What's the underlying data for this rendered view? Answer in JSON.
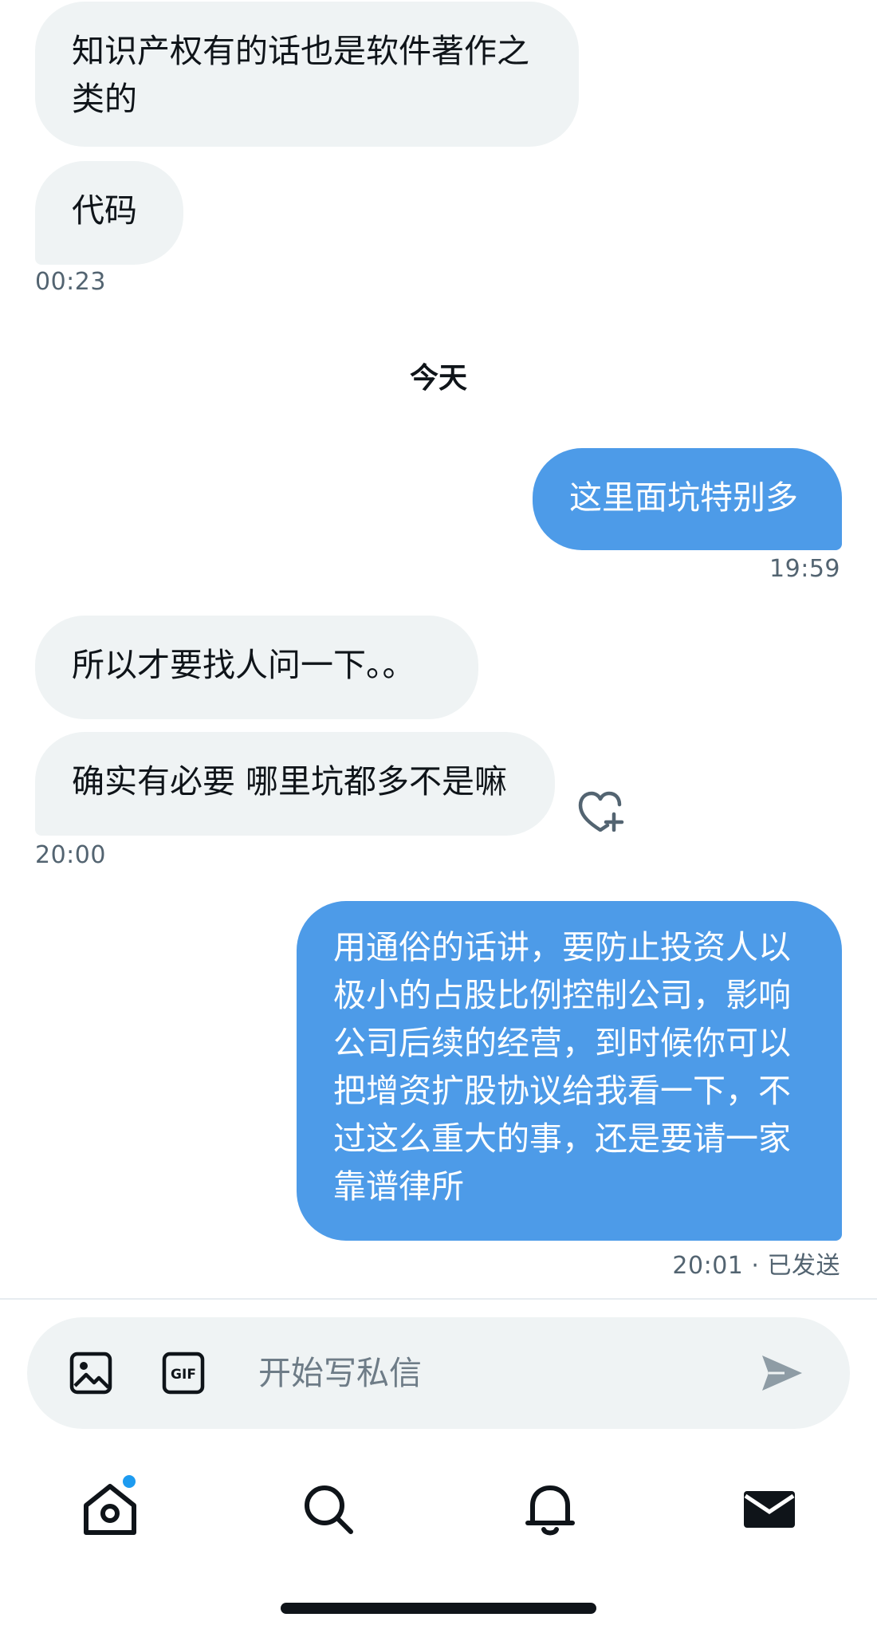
{
  "messages": [
    {
      "text": "知识产权有的话也是软件著作之类的",
      "sender": "other"
    },
    {
      "text": "代码",
      "sender": "other",
      "time": "00:23"
    },
    {
      "separator": "今天"
    },
    {
      "text": "这里面坑特别多",
      "sender": "me",
      "time": "19:59"
    },
    {
      "text": "所以才要找人问一下。。",
      "sender": "other"
    },
    {
      "text": "确实有必要 哪里坑都多不是嘛",
      "sender": "other",
      "time": "20:00",
      "reaction_icon": "heart-plus-icon"
    },
    {
      "text": "用通俗的话讲，要防止投资人以极小的占股比例控制公司，影响公司后续的经营，到时候你可以把增资扩股协议给我看一下，不过这么重大的事，还是要请一家靠谱律所",
      "sender": "me",
      "time": "20:01 · 已发送"
    }
  ],
  "composer": {
    "placeholder": "开始写私信",
    "value": "",
    "icons": [
      "image-icon",
      "gif-icon",
      "send-icon"
    ]
  },
  "tabbar": {
    "items": [
      {
        "icon": "home-icon",
        "unread": true
      },
      {
        "icon": "search-icon",
        "unread": false
      },
      {
        "icon": "bell-icon",
        "unread": false
      },
      {
        "icon": "mail-icon",
        "active": true
      }
    ]
  },
  "colors": {
    "incoming_bubble": "#eff3f4",
    "outgoing_bubble": "#4d9be8",
    "accent": "#1d9bf0",
    "muted_text": "#536471"
  }
}
